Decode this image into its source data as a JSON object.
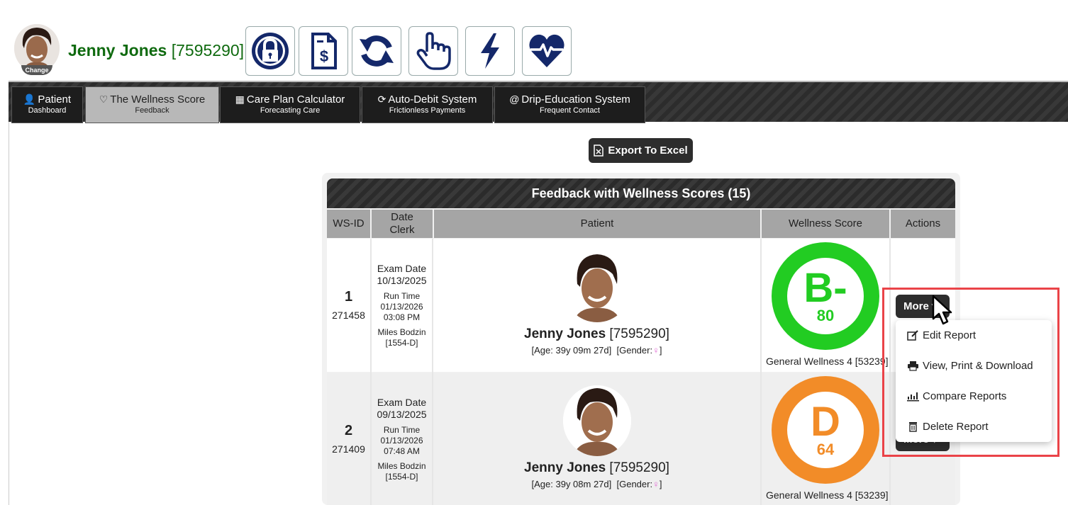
{
  "header": {
    "patient_name": "Jenny Jones",
    "patient_id": "[7595290]",
    "avatar_badge": "Change",
    "toolbar_icons": [
      "lock-icon",
      "invoice-icon",
      "sync-icon",
      "hand-pointer-icon",
      "bolt-icon",
      "heart-pulse-icon"
    ]
  },
  "nav": {
    "tabs": [
      {
        "icon": "user",
        "label": "Patient",
        "sub": "Dashboard",
        "active": false
      },
      {
        "icon": "heartbeat",
        "label": "The Wellness Score",
        "sub": "Feedback",
        "active": true
      },
      {
        "icon": "calculator",
        "label": "Care Plan Calculator",
        "sub": "Forecasting Care",
        "active": false
      },
      {
        "icon": "refresh",
        "label": "Auto-Debit System",
        "sub": "Frictionless Payments",
        "active": false
      },
      {
        "icon": "at",
        "label": "Drip-Education System",
        "sub": "Frequent Contact",
        "active": false
      }
    ]
  },
  "toolbar": {
    "export_label": "Export To Excel"
  },
  "table": {
    "title": "Feedback with Wellness Scores (15)",
    "headers": {
      "wsid": "WS-ID",
      "date": "Date",
      "clerk": "Clerk",
      "patient": "Patient",
      "score": "Wellness Score",
      "actions": "Actions"
    },
    "rows": [
      {
        "ws_num": "1",
        "ws_id": "271458",
        "exam_label": "Exam Date",
        "exam_date": "10/13/2025",
        "run_label": "Run Time",
        "run_date": "01/13/2026",
        "run_time": "03:08 PM",
        "clerk_name": "Miles Bodzin",
        "clerk_id": "[1554-D]",
        "patient_name": "Jenny Jones",
        "patient_id": "[7595290]",
        "age_text": "[Age: 39y 09m 27d]",
        "gender_label": "[Gender:",
        "gender_symbol": "♀",
        "gender_close": "]",
        "grade": "B-",
        "score": "80",
        "score_color": "#22cc22",
        "assessment": "General Wellness 4 [53239]",
        "more_label": "More"
      },
      {
        "ws_num": "2",
        "ws_id": "271409",
        "exam_label": "Exam Date",
        "exam_date": "09/13/2025",
        "run_label": "Run Time",
        "run_date": "01/13/2026",
        "run_time": "07:48 AM",
        "clerk_name": "Miles Bodzin",
        "clerk_id": "[1554-D]",
        "patient_name": "Jenny Jones",
        "patient_id": "[7595290]",
        "age_text": "[Age: 39y 08m 27d]",
        "gender_label": "[Gender:",
        "gender_symbol": "♀",
        "gender_close": "]",
        "grade": "D",
        "score": "64",
        "score_color": "#f28c28",
        "assessment": "General Wellness 4 [53239]",
        "more_label": "More"
      }
    ]
  },
  "dropdown": {
    "items": [
      {
        "icon": "edit-icon",
        "label": "Edit Report"
      },
      {
        "icon": "print-icon",
        "label": "View, Print & Download"
      },
      {
        "icon": "chart-icon",
        "label": "Compare Reports"
      },
      {
        "icon": "trash-icon",
        "label": "Delete Report"
      }
    ]
  },
  "colors": {
    "name_green": "#0f6a0f",
    "highlight_red": "#ea4348",
    "icon_navy": "#14286a"
  }
}
